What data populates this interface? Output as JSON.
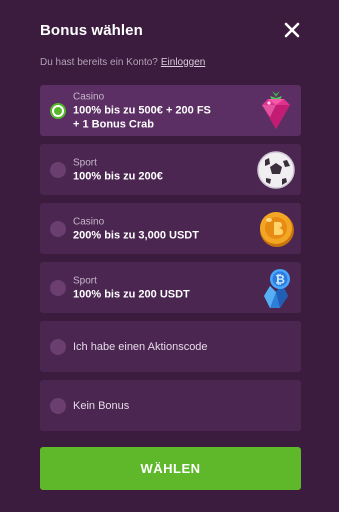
{
  "header": {
    "title": "Bonus wählen",
    "close_icon": "close-icon"
  },
  "login": {
    "text": "Du hast bereits ein Konto?",
    "link": "Einloggen"
  },
  "options": [
    {
      "category": "Casino",
      "line1": "100% bis zu 500€ + 200 FS",
      "line2": "+ 1 Bonus Crab",
      "icon": "raspberry-gem-icon",
      "selected": true
    },
    {
      "category": "Sport",
      "line1": "100% bis zu 200€",
      "icon": "soccer-ball-icon",
      "selected": false
    },
    {
      "category": "Casino",
      "line1": "200% bis zu 3,000 USDT",
      "icon": "gold-coin-icon",
      "selected": false
    },
    {
      "category": "Sport",
      "line1": "100% bis zu 200 USDT",
      "icon": "bitcoin-crystal-icon",
      "selected": false
    },
    {
      "label": "Ich habe einen Aktionscode",
      "selected": false
    },
    {
      "label": "Kein Bonus",
      "selected": false
    }
  ],
  "button": {
    "label": "WÄHLEN"
  },
  "colors": {
    "background": "#3b1c3e",
    "option": "#4a2650",
    "selected_option": "#5b2f63",
    "accent_green": "#5fb82a"
  }
}
